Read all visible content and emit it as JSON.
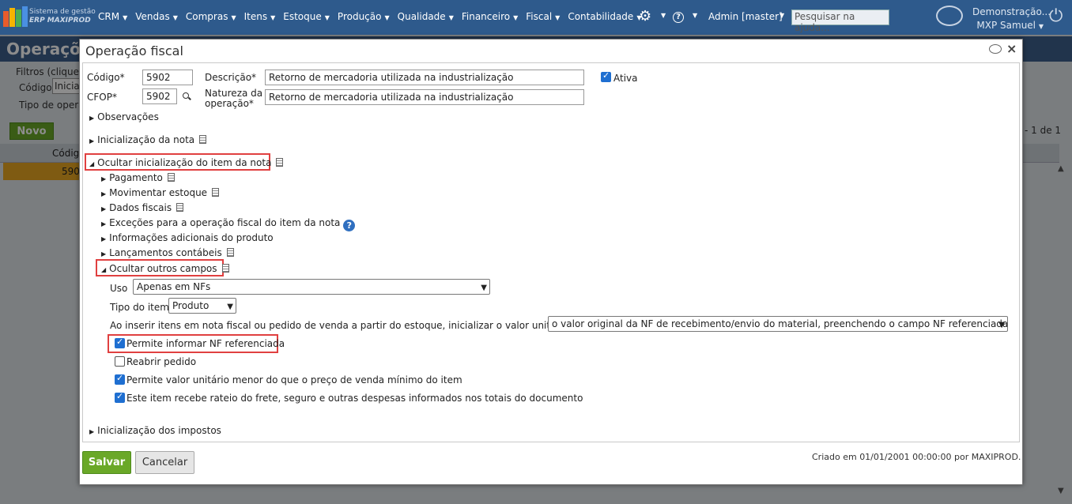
{
  "nav": {
    "brand_line1": "Sistema de gestão",
    "brand_line2": "ERP MAXIPROD",
    "menu": [
      "CRM",
      "Vendas",
      "Compras",
      "Itens",
      "Estoque",
      "Produção",
      "Qualidade",
      "Financeiro",
      "Fiscal",
      "Contabilidade"
    ],
    "admin": "Admin [master]",
    "search_placeholder": "Pesquisar na ajuda...",
    "company": "Demonstração...",
    "user": "MXP Samuel",
    "icons": [
      "gear-icon",
      "help-icon",
      "chat-icon",
      "power-icon"
    ]
  },
  "background": {
    "page_title": "Operaçõ",
    "filters_label": "Filtros (clique",
    "codigo_label": "Código",
    "codigo_value": "Inicia",
    "tipo_label": "Tipo de operaç",
    "novo_button": "Novo",
    "pager": "- 1 de 1",
    "grid_header": "Códig",
    "grid_value": "590"
  },
  "modal": {
    "title": "Operação fiscal",
    "codigo_label": "Código*",
    "codigo_value": "5902",
    "cfop_label": "CFOP*",
    "cfop_value": "5902",
    "descricao_label": "Descrição*",
    "descricao_value": "Retorno de mercadoria utilizada na industrialização",
    "natureza_label_1": "Natureza da",
    "natureza_label_2": "operação*",
    "natureza_value": "Retorno de mercadoria utilizada na industrialização",
    "ativa_label": "Ativa",
    "ativa_checked": true,
    "sections": {
      "observacoes": "Observações",
      "inicializacao_nota": "Inicialização da nota",
      "ocultar_inicializacao_item": "Ocultar inicialização do item da nota",
      "pagamento": "Pagamento",
      "movimentar_estoque": "Movimentar estoque",
      "dados_fiscais": "Dados fiscais",
      "excecoes": "Exceções para a operação fiscal do item da nota",
      "informacoes_adicionais": "Informações adicionais do produto",
      "lancamentos_contabeis": "Lançamentos contábeis",
      "ocultar_outros_campos": "Ocultar outros campos",
      "inicializacao_impostos": "Inicialização dos impostos"
    },
    "uso_label": "Uso",
    "uso_value": "Apenas em NFs",
    "tipo_item_label": "Tipo do item",
    "tipo_item_value": "Produto",
    "inserir_label": "Ao inserir itens em nota fiscal ou pedido de venda a partir do estoque, inicializar o valor unitário com:",
    "inserir_value": "o valor original da NF de recebimento/envio do material, preenchendo o campo NF referenciada do item",
    "checkboxes": [
      {
        "label": "Permite informar NF referenciada",
        "checked": true
      },
      {
        "label": "Reabrir pedido",
        "checked": false
      },
      {
        "label": "Permite valor unitário menor do que o preço de venda mínimo do item",
        "checked": true
      },
      {
        "label": "Este item recebe rateio do frete, seguro e outras despesas informados nos totais do documento",
        "checked": true
      }
    ],
    "save_button": "Salvar",
    "cancel_button": "Cancelar",
    "footer_note": "Criado em 01/01/2001 00:00:00 por MAXIPROD.",
    "highlight_color": "#e04040",
    "accent_green": "#6aa828"
  }
}
